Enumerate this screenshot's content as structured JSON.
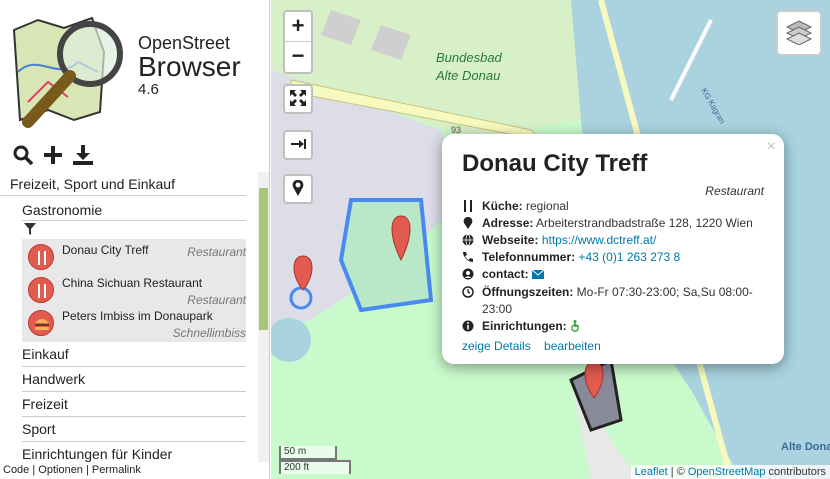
{
  "app": {
    "name_line1": "OpenStreet",
    "name_line2": "Browser",
    "version": "4.6"
  },
  "toolbar": {
    "icons": [
      "search-icon",
      "plus-icon",
      "download-icon"
    ]
  },
  "categories": {
    "top": "Freizeit, Sport und Einkauf",
    "sub": "Gastronomie",
    "pois": [
      {
        "name": "Donau City Treff",
        "type": "Restaurant",
        "icon": "fork-knife-icon"
      },
      {
        "name": "China Sichuan Restaurant",
        "type": "Restaurant",
        "icon": "fork-knife-icon"
      },
      {
        "name": "Peters Imbiss im Donaupark",
        "type": "Schnellimbiss",
        "icon": "burger-icon"
      }
    ],
    "others": [
      "Einkauf",
      "Handwerk",
      "Freizeit",
      "Sport",
      "Einrichtungen für Kinder"
    ]
  },
  "footer": {
    "code": "Code",
    "sep1": " | ",
    "options": "Optionen",
    "sep2": " | ",
    "permalink": "Permalink"
  },
  "map": {
    "zoom_in": "+",
    "zoom_out": "−",
    "labels": {
      "bad1": "Bundesbad",
      "bad2": "Alte Donau",
      "street": "KG Kagran",
      "num": "93",
      "alte": "Alte Dona"
    },
    "scale": {
      "m": "50 m",
      "ft": "200 ft"
    },
    "attribution": {
      "leaflet": "Leaflet",
      "sep": " | © ",
      "osm": "OpenStreetMap",
      "contrib": " contributors"
    }
  },
  "popup": {
    "title": "Donau City Treff",
    "category": "Restaurant",
    "rows": {
      "kueche_label": "Küche:",
      "kueche": "regional",
      "adresse_label": "Adresse:",
      "adresse": "Arbeiterstrandbadstraße 128, 1220 Wien",
      "web_label": "Webseite:",
      "web": "https://www.dctreff.at/",
      "tel_label": "Telefonnummer:",
      "tel": "+43 (0)1 263 273 8",
      "contact_label": "contact:",
      "hours_label": "Öffnungszeiten:",
      "hours": "Mo-Fr 07:30-23:00; Sa,Su 08:00-23:00",
      "facilities_label": "Einrichtungen:"
    },
    "details_link": "zeige Details",
    "edit_link": "bearbeiten",
    "close": "×"
  },
  "colors": {
    "accent": "#a8c776",
    "link": "#0078a8",
    "marker": "#e25b4f",
    "water": "#aad3df",
    "park": "#c8facc"
  }
}
